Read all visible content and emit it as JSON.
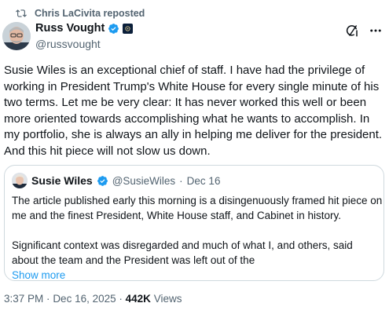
{
  "repost": {
    "icon": "repost-icon",
    "text": "Chris LaCivita reposted"
  },
  "author": {
    "name": "Russ Vought",
    "handle": "@russvought",
    "verified_color": "#1d9bf0"
  },
  "actions": {
    "grok_icon": "grok-icon",
    "more_icon": "more-icon"
  },
  "tweet": {
    "lines": [
      "Susie Wiles is an exceptional chief of staff. I have had the privilege of",
      "working in President Trump's White House for every single minute of his",
      "two terms. Let me be very clear: It has never worked this well or been",
      "more oriented towards accomplishing what he wants to accomplish. In",
      "my portfolio, she is always an ally in helping me deliver for the president.",
      "And this hit piece will not slow us down."
    ]
  },
  "quote": {
    "name": "Susie Wiles",
    "handle": "@SusieWiles",
    "separator": "·",
    "date": "Dec 16",
    "paragraph1": [
      "The article published early this morning is a disingenuously framed hit piece on",
      "me and the finest President, White House staff, and Cabinet in history."
    ],
    "paragraph2": [
      "Significant context was disregarded and much of what I, and others, said",
      "about the team and the President was left out of the"
    ],
    "show_more": "Show more"
  },
  "meta": {
    "time": "3:37 PM",
    "sep": "·",
    "date": "Dec 16, 2025",
    "views_count": "442K",
    "views_label": "Views"
  }
}
